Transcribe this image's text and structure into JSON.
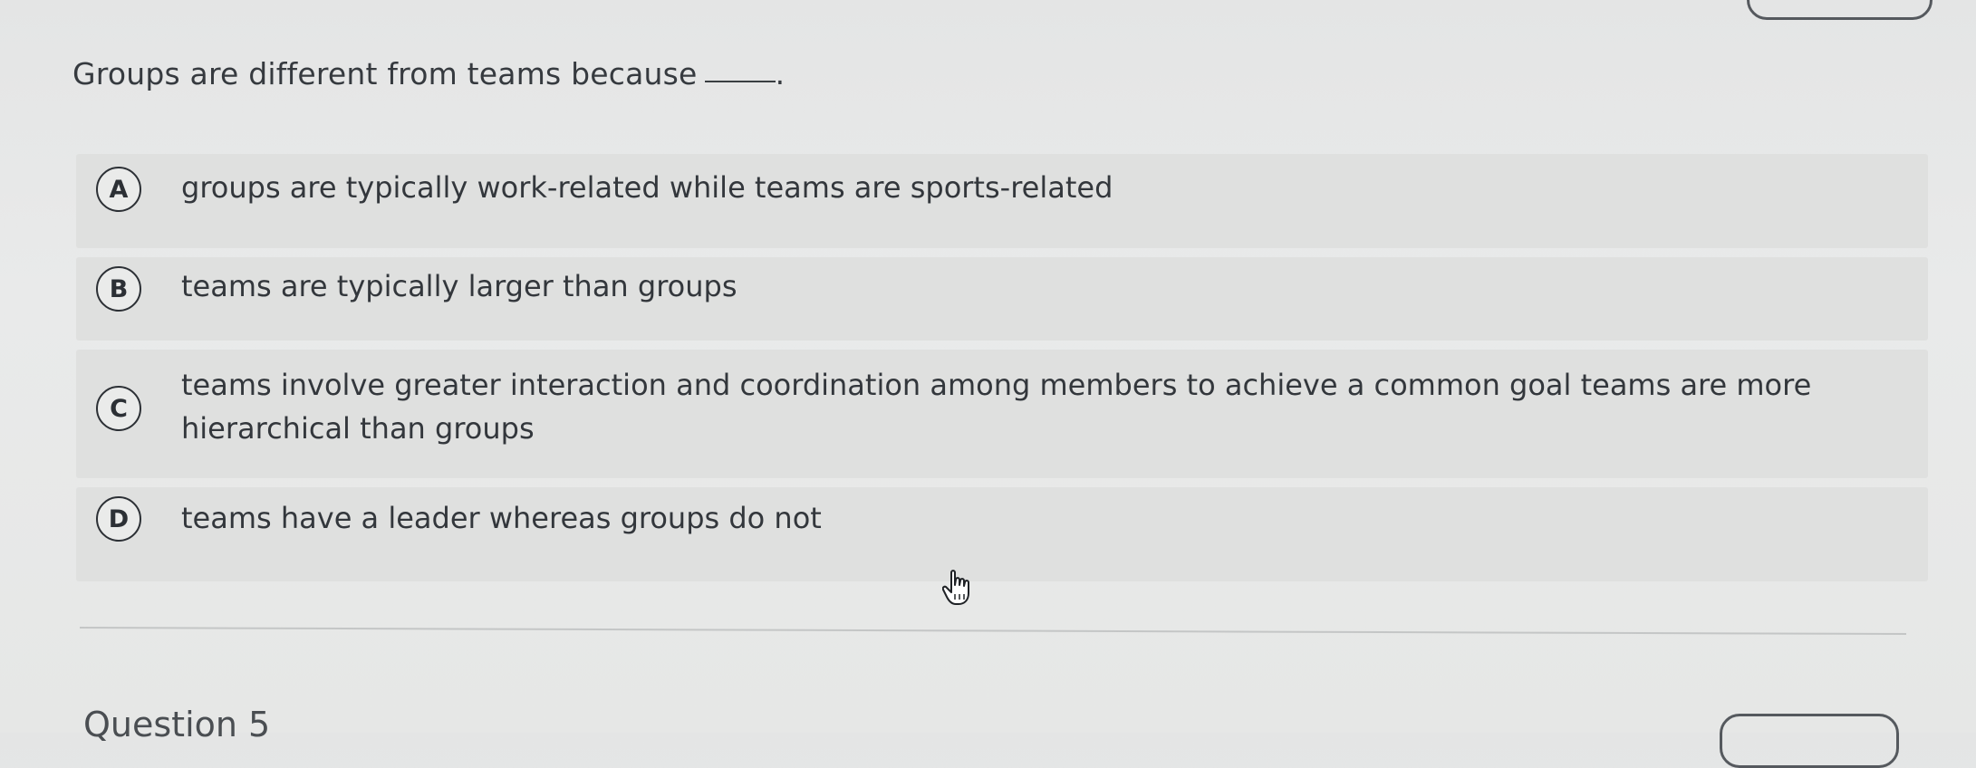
{
  "question": {
    "text": "Groups are different from teams because",
    "blank_suffix": "."
  },
  "options": [
    {
      "letter": "A",
      "text": "groups are typically work-related while teams are sports-related"
    },
    {
      "letter": "B",
      "text": "teams are typically larger than groups"
    },
    {
      "letter": "C",
      "text": "teams involve greater interaction and coordination among members to achieve a common goal teams are more hierarchical than groups"
    },
    {
      "letter": "D",
      "text": "teams have a leader whereas groups do not"
    }
  ],
  "next_question": {
    "heading": "Question 5"
  },
  "icons": {
    "cursor": "hand-pointer-icon"
  }
}
